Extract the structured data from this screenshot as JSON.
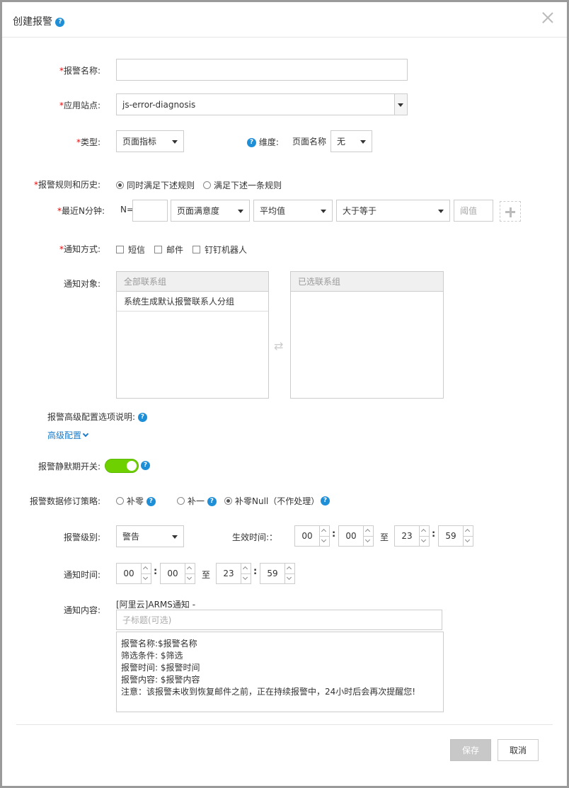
{
  "dialog": {
    "title": "创建报警"
  },
  "form": {
    "alarm_name": {
      "label": "报警名称:",
      "value": ""
    },
    "app_site": {
      "label": "应用站点:",
      "value": "js-error-diagnosis"
    },
    "type": {
      "label": "类型:",
      "value": "页面指标"
    },
    "dimension": {
      "label": "维度:",
      "field": "页面名称",
      "value": "无"
    },
    "rules": {
      "label": "报警规则和历史:",
      "options": [
        "同时满足下述规则",
        "满足下述一条规则"
      ],
      "selected": 0
    },
    "recent_n": {
      "label": "最近N分钟:",
      "n_label": "N=",
      "n_value": "",
      "metric": "页面满意度",
      "agg": "平均值",
      "op": "大于等于",
      "threshold_placeholder": "阈值"
    },
    "notify_method": {
      "label": "通知方式:",
      "options": [
        "短信",
        "邮件",
        "钉钉机器人"
      ]
    },
    "notify_target": {
      "label": "通知对象:",
      "all_header": "全部联系组",
      "all_items": [
        "系统生成默认报警联系人分组"
      ],
      "selected_header": "已选联系组"
    },
    "advanced": {
      "label": "报警高级配置选项说明:",
      "link": "高级配置"
    },
    "silence": {
      "label": "报警静默期开关:",
      "on": true
    },
    "revise": {
      "label": "报警数据修订策略:",
      "options": [
        "补零",
        "补一",
        "补零Null（不作处理）"
      ],
      "selected": 2
    },
    "level": {
      "label": "报警级别:",
      "value": "警告"
    },
    "effective": {
      "label": "生效时间:：",
      "from_h": "00",
      "from_m": "00",
      "to": "至",
      "to_h": "23",
      "to_m": "59"
    },
    "notify_time": {
      "label": "通知时间:",
      "from_h": "00",
      "from_m": "00",
      "to": "至",
      "to_h": "23",
      "to_m": "59"
    },
    "notify_content": {
      "label": "通知内容:",
      "prefix": "[阿里云]ARMS通知 -",
      "subtitle_placeholder": "子标题(可选)",
      "lines": [
        "报警名称:$报警名称",
        "筛选条件: $筛选",
        "报警时间: $报警时间",
        "报警内容: $报警内容",
        "注意：该报警未收到恢复邮件之前，正在持续报警中，24小时后会再次提醒您!"
      ]
    }
  },
  "footer": {
    "save": "保存",
    "cancel": "取消"
  },
  "colors": {
    "accent": "#1e8fd6",
    "toggle_on": "#6fd000",
    "required": "#ee0000"
  },
  "icons": {
    "help": "question-circle-icon",
    "close": "close-icon",
    "swap": "swap-arrows-icon",
    "plus": "plus-icon"
  }
}
